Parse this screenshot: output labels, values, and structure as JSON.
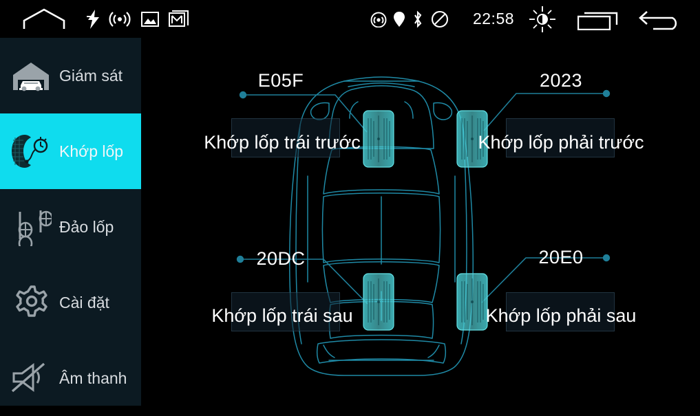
{
  "statusbar": {
    "time": "22:58",
    "left_icons": [
      {
        "name": "home-icon",
        "glyph": "home"
      },
      {
        "name": "bolt-icon",
        "glyph": "bolt"
      },
      {
        "name": "broadcast-icon",
        "glyph": "broadcast"
      },
      {
        "name": "gallery-icon",
        "glyph": "gallery"
      },
      {
        "name": "mail-icon",
        "glyph": "mail"
      }
    ],
    "right_icons": [
      {
        "name": "hotspot-icon",
        "glyph": "hotspot"
      },
      {
        "name": "location-icon",
        "glyph": "location"
      },
      {
        "name": "bluetooth-icon",
        "glyph": "bluetooth"
      },
      {
        "name": "mute-ring-icon",
        "glyph": "noentry"
      },
      {
        "name": "brightness-icon",
        "glyph": "brightness"
      },
      {
        "name": "recents-icon",
        "glyph": "recents"
      },
      {
        "name": "back-icon",
        "glyph": "back"
      }
    ]
  },
  "sidebar": {
    "active_index": 1,
    "active_bg": "#0fdcee",
    "bg": "#0c1a22",
    "items": [
      {
        "label": "Giám sát",
        "icon": "garage-car-icon",
        "active": false
      },
      {
        "label": "Khớp lốp",
        "icon": "tire-gauge-icon",
        "active": true
      },
      {
        "label": "Đảo lốp",
        "icon": "tire-rotation-icon",
        "active": false
      },
      {
        "label": "Cài đặt",
        "icon": "gear-icon",
        "active": false
      },
      {
        "label": "Âm thanh",
        "icon": "speaker-mute-icon",
        "active": false
      }
    ]
  },
  "main": {
    "accent": "#2ea9c4",
    "tire_fill": "#3ec8cf",
    "tires": [
      {
        "position": "front-left",
        "id": "E05F",
        "name": "Khớp lốp trái trước"
      },
      {
        "position": "front-right",
        "id": "2023",
        "name": "Khớp lốp phải trước"
      },
      {
        "position": "rear-left",
        "id": "20DC",
        "name": "Khớp lốp trái sau"
      },
      {
        "position": "rear-right",
        "id": "20E0",
        "name": "Khớp lốp phải sau"
      }
    ]
  }
}
